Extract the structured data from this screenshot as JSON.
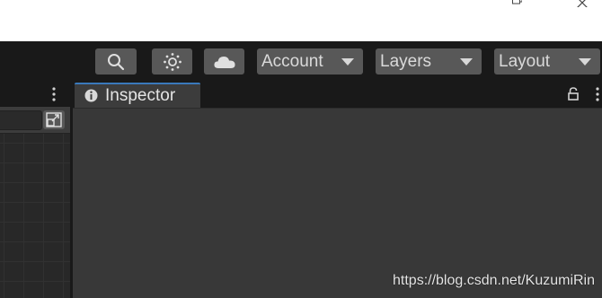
{
  "window": {
    "restore_icon": "restore-window-icon",
    "close_icon": "close-window-icon"
  },
  "toolbar": {
    "search_icon": "search-icon",
    "lighting_icon": "lighting-sun-icon",
    "cloud_icon": "cloud-icon",
    "account_label": "Account",
    "layers_label": "Layers",
    "layout_label": "Layout"
  },
  "left_panel": {
    "menu_icon": "kebab-menu-icon",
    "maximize_icon": "maximize-icon"
  },
  "inspector": {
    "tab_label": "Inspector",
    "info_icon": "info-icon",
    "lock_icon": "lock-icon",
    "menu_icon": "kebab-menu-icon",
    "accent": "#3a79bb"
  },
  "watermark": "https://blog.csdn.net/KuzumiRin"
}
